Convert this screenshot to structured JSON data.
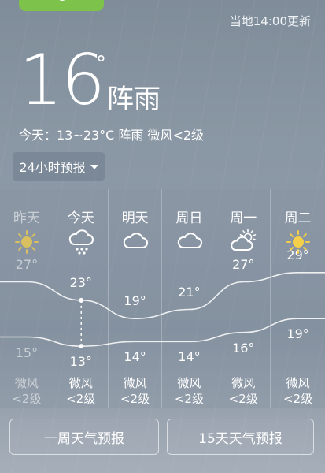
{
  "header": {
    "update_text": "当地14:00更新",
    "current_temp": "16",
    "degree_symbol": "°",
    "condition": "阵雨",
    "today_summary": "今天：13~23°C  阵雨  微风<2级",
    "mode_button": "24小时预报"
  },
  "forecast": {
    "days": [
      {
        "day": "昨天",
        "icon": "sun-icon",
        "high": "27°",
        "low": "15°",
        "wind1": "微风",
        "wind2": "<2级",
        "past": true
      },
      {
        "day": "今天",
        "icon": "rain-cloud-icon",
        "high": "23°",
        "low": "13°",
        "wind1": "微风",
        "wind2": "<2级",
        "past": false
      },
      {
        "day": "明天",
        "icon": "cloud-icon",
        "high": "19°",
        "low": "14°",
        "wind1": "微风",
        "wind2": "<2级",
        "past": false
      },
      {
        "day": "周日",
        "icon": "cloud-icon",
        "high": "21°",
        "low": "14°",
        "wind1": "微风",
        "wind2": "<2级",
        "past": false
      },
      {
        "day": "周一",
        "icon": "partly-sunny-icon",
        "high": "27°",
        "low": "16°",
        "wind1": "微风",
        "wind2": "<2级",
        "past": false
      },
      {
        "day": "周二",
        "icon": "sun-icon",
        "high": "29°",
        "low": "19°",
        "wind1": "微风",
        "wind2": "<2级",
        "past": false
      }
    ]
  },
  "chart_data": {
    "type": "line",
    "categories": [
      "昨天",
      "今天",
      "明天",
      "周日",
      "周一",
      "周二"
    ],
    "series": [
      {
        "values": [
          27,
          23,
          19,
          21,
          27,
          29
        ]
      },
      {
        "values": [
          15,
          13,
          14,
          14,
          16,
          19
        ]
      }
    ]
  },
  "buttons": {
    "week": "一周天气预报",
    "fifteen": "15天天气预报"
  },
  "colors": {
    "accent_green": "#7dc24a",
    "sun_yellow": "#f3cf4a"
  }
}
